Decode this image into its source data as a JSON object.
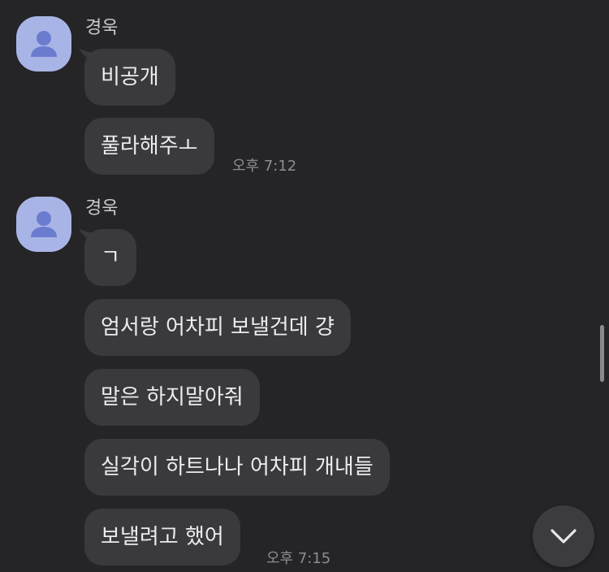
{
  "colors": {
    "background": "#252527",
    "bubble": "#3a3a3d",
    "avatar": "#a9b4e6",
    "avatar_icon": "#6b7ccf",
    "text": "#ececee",
    "timestamp": "#8d8d91"
  },
  "groups": [
    {
      "sender": "경욱",
      "avatar_icon": "person-icon",
      "messages": [
        "비공개",
        "풀라해주ㅗ"
      ],
      "time": "오후 7:12"
    },
    {
      "sender": "경욱",
      "avatar_icon": "person-icon",
      "messages": [
        "ㄱ",
        "엄서랑 어차피 보낼건데 걍",
        "말은 하지말아줘",
        "실각이 하트나나 어차피 개내들",
        "보낼려고 했어"
      ],
      "time": "오후 7:15"
    }
  ],
  "scroll_down_icon": "chevron-down-icon"
}
